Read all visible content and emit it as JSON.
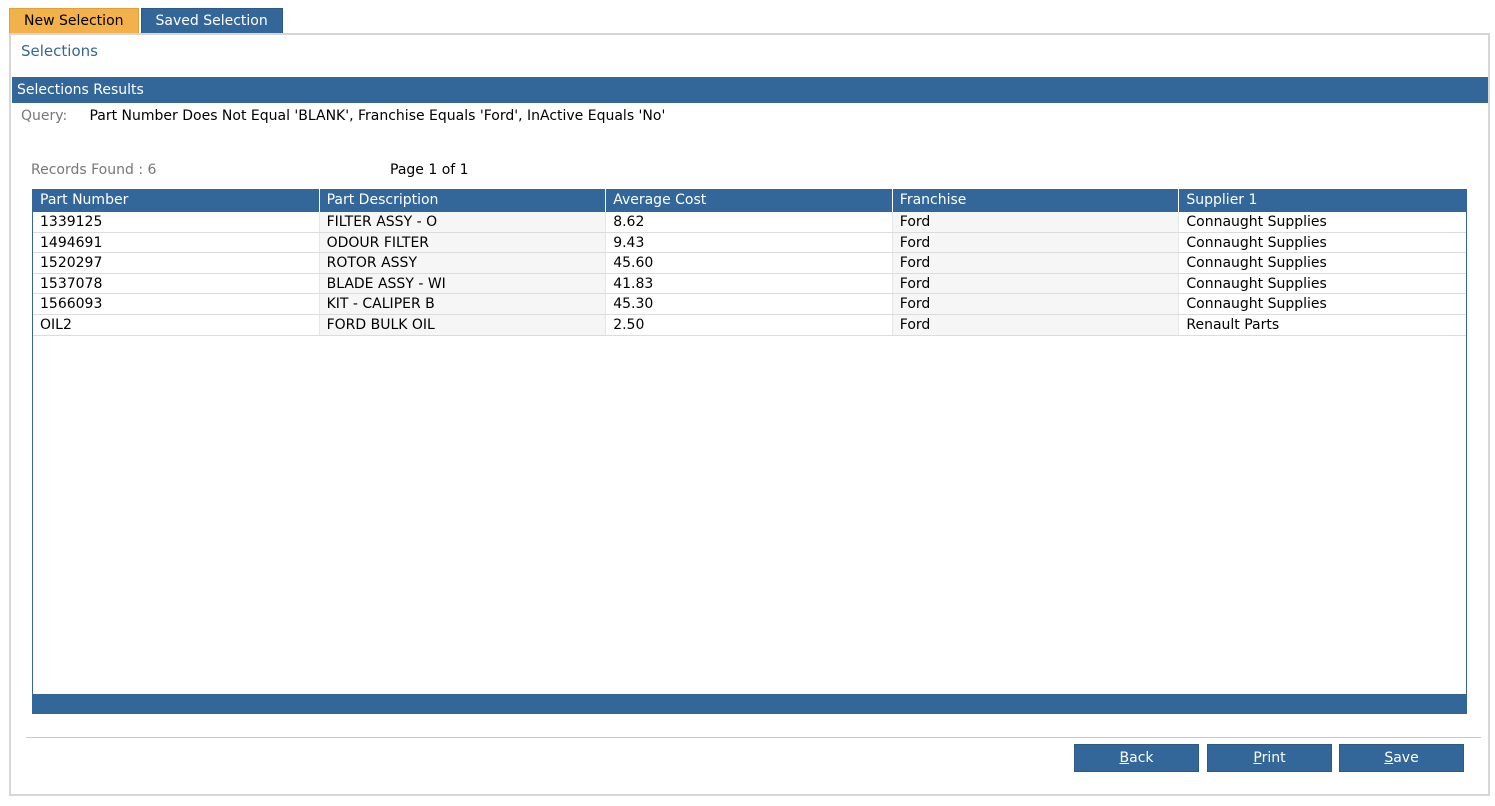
{
  "tabs": [
    {
      "label": "New Selection",
      "active": true
    },
    {
      "label": "Saved Selection",
      "active": false
    }
  ],
  "section_title": "Selections",
  "results_title": "Selections Results",
  "query": {
    "label": "Query:",
    "text": "Part Number Does Not Equal 'BLANK', Franchise Equals 'Ford', InActive Equals 'No'"
  },
  "records_found": "Records Found : 6",
  "page_info": "Page 1 of 1",
  "table": {
    "columns": [
      "Part Number",
      "Part Description",
      "Average Cost",
      "Franchise",
      "Supplier 1"
    ],
    "rows": [
      [
        "1339125",
        "FILTER ASSY - O",
        "8.62",
        "Ford",
        "Connaught Supplies"
      ],
      [
        "1494691",
        "ODOUR FILTER",
        "9.43",
        "Ford",
        "Connaught Supplies"
      ],
      [
        "1520297",
        "ROTOR ASSY",
        "45.60",
        "Ford",
        "Connaught Supplies"
      ],
      [
        "1537078",
        "BLADE ASSY - WI",
        "41.83",
        "Ford",
        "Connaught Supplies"
      ],
      [
        "1566093",
        "KIT - CALIPER B",
        "45.30",
        "Ford",
        "Connaught Supplies"
      ],
      [
        "OIL2",
        "FORD BULK OIL",
        "2.50",
        "Ford",
        "Renault Parts"
      ]
    ]
  },
  "buttons": {
    "back": {
      "accel": "B",
      "rest": "ack"
    },
    "print": {
      "accel": "P",
      "rest": "rint"
    },
    "save": {
      "accel": "S",
      "rest": "ave"
    }
  },
  "colors": {
    "accent": "#336699",
    "active_tab": "#f3b14c"
  }
}
